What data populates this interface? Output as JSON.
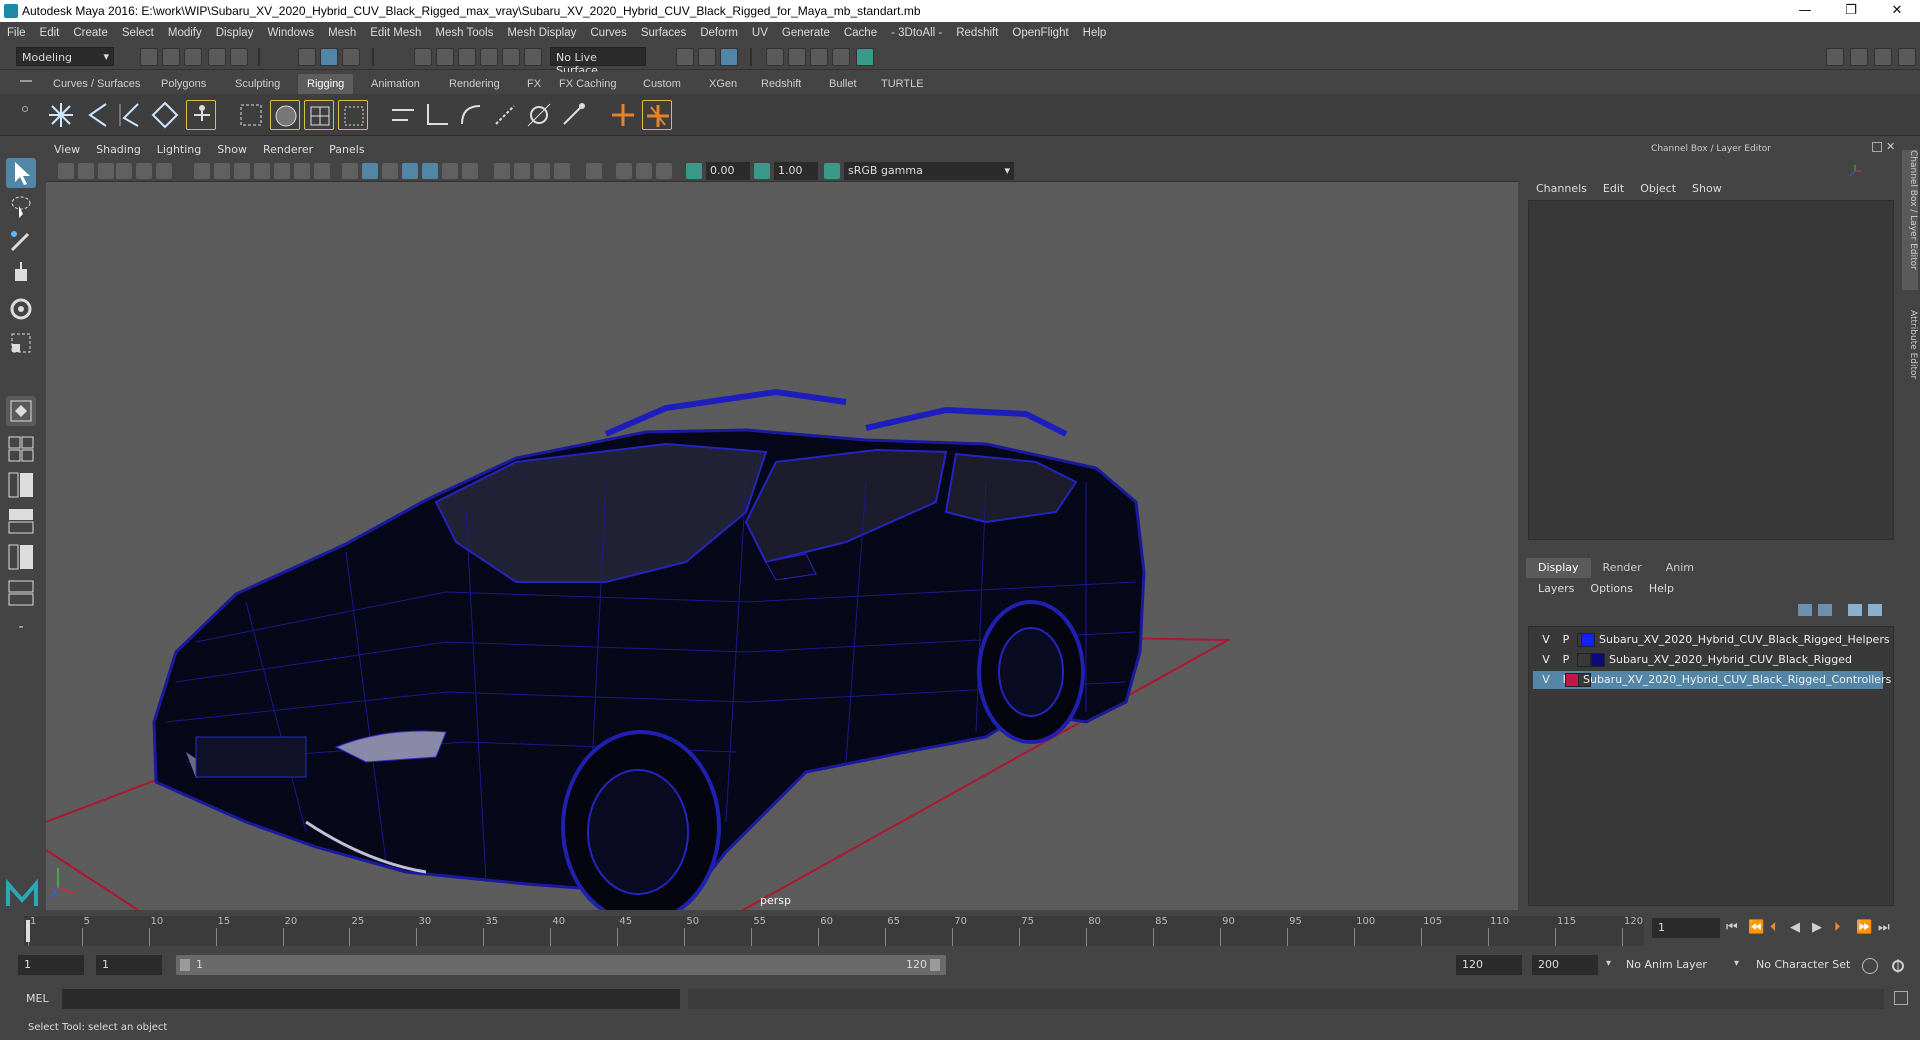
{
  "title_bar": {
    "title": "Autodesk Maya 2016: E:\\work\\WIP\\Subaru_XV_2020_Hybrid_CUV_Black_Rigged_max_vray\\Subaru_XV_2020_Hybrid_CUV_Black_Rigged_for_Maya_mb_standart.mb",
    "minimize": "—",
    "restore": "❐",
    "close": "✕"
  },
  "menu": [
    "File",
    "Edit",
    "Create",
    "Select",
    "Modify",
    "Display",
    "Windows",
    "Mesh",
    "Edit Mesh",
    "Mesh Tools",
    "Mesh Display",
    "Curves",
    "Surfaces",
    "Deform",
    "UV",
    "Generate",
    "Cache",
    "- 3DtoAll -",
    "Redshift",
    "OpenFlight",
    "Help"
  ],
  "status_line": {
    "mode": "Modeling",
    "live_surface": "No Live Surface"
  },
  "shelf_tabs": [
    "Curves / Surfaces",
    "Polygons",
    "Sculpting",
    "Rigging",
    "Animation",
    "Rendering",
    "FX",
    "FX Caching",
    "Custom",
    "XGen",
    "Redshift",
    "Bullet",
    "TURTLE"
  ],
  "active_shelf_tab": "Rigging",
  "viewport_menu": [
    "View",
    "Shading",
    "Lighting",
    "Show",
    "Renderer",
    "Panels"
  ],
  "viewport_toolbar": {
    "exposure": "0.00",
    "gamma": "1.00",
    "color_space": "sRGB gamma"
  },
  "viewport": {
    "camera_label": "persp"
  },
  "channel_box": {
    "title": "Channel Box / Layer Editor",
    "menu": [
      "Channels",
      "Edit",
      "Object",
      "Show"
    ]
  },
  "layer_editor": {
    "tabs": [
      "Display",
      "Render",
      "Anim"
    ],
    "active_tab": "Display",
    "menu": [
      "Layers",
      "Options",
      "Help"
    ],
    "layers": [
      {
        "v": "V",
        "p": "P",
        "color": "#1020ff",
        "name": "Subaru_XV_2020_Hybrid_CUV_Black_Rigged_Helpers",
        "selected": false
      },
      {
        "v": "V",
        "p": "P",
        "color": "#0a0a7a",
        "name": "Subaru_XV_2020_Hybrid_CUV_Black_Rigged",
        "selected": false
      },
      {
        "v": "V",
        "p": "P",
        "color": "#c0184a",
        "name": "Subaru_XV_2020_Hybrid_CUV_Black_Rigged_Controllers",
        "selected": true
      }
    ]
  },
  "side_tabs": [
    "Channel Box / Layer Editor",
    "Attribute Editor"
  ],
  "time_slider": {
    "ticks": [
      "1",
      "5",
      "10",
      "15",
      "20",
      "25",
      "30",
      "35",
      "40",
      "45",
      "50",
      "55",
      "60",
      "65",
      "70",
      "75",
      "80",
      "85",
      "90",
      "95",
      "100",
      "105",
      "110",
      "115",
      "120"
    ],
    "current_frame": "1"
  },
  "range_slider": {
    "start": "1",
    "playback_start": "1",
    "range_start_label": "1",
    "range_end_label": "120",
    "playback_end": "120",
    "end": "200",
    "anim_layer": "No Anim Layer",
    "character_set": "No Character Set"
  },
  "command_line": {
    "label": "MEL"
  },
  "help_line": "Select Tool: select an object"
}
